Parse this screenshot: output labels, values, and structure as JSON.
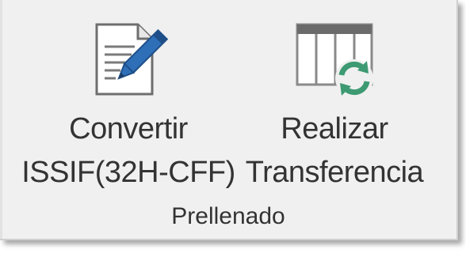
{
  "ribbon_group": {
    "label": "Prellenado",
    "buttons": [
      {
        "id": "convert",
        "icon": "document-edit-icon",
        "label_line1": "Convertir",
        "label_line2": "ISSIF(32H-CFF)"
      },
      {
        "id": "transfer",
        "icon": "table-refresh-icon",
        "label_line1": "Realizar",
        "label_line2": "Transferencia"
      }
    ]
  },
  "colors": {
    "ribbon_background": "#f0f0f0",
    "text": "#333333",
    "pencil_blue": "#2f6fb8",
    "refresh_green": "#3d9a72",
    "table_header": "#6b6b6b"
  }
}
